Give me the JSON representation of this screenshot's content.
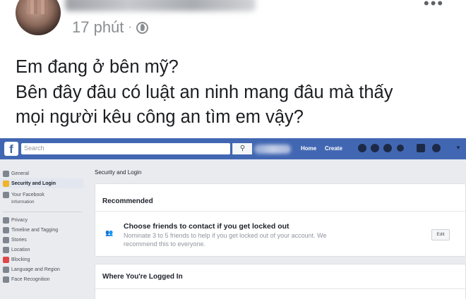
{
  "post": {
    "time": "17 phút",
    "separator": "·",
    "lines": [
      "Em đang ở bên mỹ?",
      "Bên đây đâu có luật an ninh mang đâu mà thấy",
      "mọi người kêu công an tìm em vậy?"
    ]
  },
  "screenshot": {
    "logo": "f",
    "search_placeholder": "Search",
    "search_button": "⚲",
    "nav": {
      "home": "Home",
      "create": "Create"
    },
    "sidebar": {
      "items": [
        {
          "label": "General",
          "icon": "gear-icon"
        },
        {
          "label": "Security and Login",
          "icon": "shield-icon"
        },
        {
          "label": "Your Facebook",
          "sub": "Information",
          "icon": "facebook-icon"
        },
        {
          "label": "Privacy",
          "icon": "lock-icon"
        },
        {
          "label": "Timeline and Tagging",
          "icon": "timeline-icon"
        },
        {
          "label": "Stories",
          "icon": "stories-icon"
        },
        {
          "label": "Location",
          "icon": "location-icon"
        },
        {
          "label": "Blocking",
          "icon": "block-icon"
        },
        {
          "label": "Language and Region",
          "icon": "language-icon"
        },
        {
          "label": "Face Recognition",
          "icon": "face-icon"
        }
      ]
    },
    "main": {
      "title": "Security and Login",
      "recommended": "Recommended",
      "choose_title": "Choose friends to contact if you get locked out",
      "choose_desc_1": "Nominate 3 to 5 friends to help if you get locked out of your account. We",
      "choose_desc_2": "recommend this to everyone.",
      "edit": "Edit",
      "logged_in": "Where You're Logged In"
    },
    "colors": {
      "brand": "#4267b2",
      "page_bg": "#e9ebee"
    }
  }
}
